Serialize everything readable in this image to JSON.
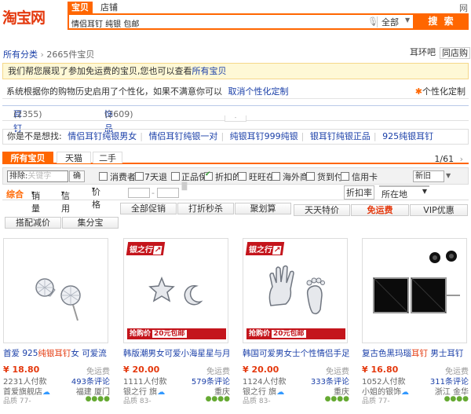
{
  "header": {
    "logo": "淘宝网",
    "tabs": [
      "宝贝",
      "店铺"
    ],
    "corner_text": "网",
    "search_value": "情侣耳钉 纯银 包邮",
    "category": "全部",
    "search_button": "搜 索"
  },
  "breadcrumb": {
    "root": "所有分类",
    "separator": "›",
    "count": "2665件宝贝",
    "right_links": [
      "耳环吧",
      "同店购"
    ]
  },
  "tips": {
    "free_ship": "我们帮您展现了参加免运费的宝贝,您也可以查看",
    "all_items_link": "所有宝贝",
    "personal": "系统根据你的购物历史启用了个性化，如果不满意你可以",
    "cancel_link": "取消个性化定制",
    "personal_right": "个性化定制"
  },
  "categories": [
    {
      "name": "耳钉",
      "count": "(2355)"
    },
    {
      "name": "饰品",
      "count": "(2609)"
    }
  ],
  "suggest": {
    "label": "你是不是想找:",
    "items": [
      "情侣耳钉纯银男女",
      "情侣耳钉纯银一对",
      "纯银耳钉999纯银",
      "银耳钉纯银正品",
      "925纯银耳钉"
    ]
  },
  "tabs": [
    "所有宝贝",
    "天猫",
    "二手"
  ],
  "pager": {
    "current": "1",
    "total": "/61"
  },
  "filter": {
    "sort_label": "排除:",
    "sort_placeholder": "关键字",
    "confirm": "确",
    "checks": [
      "消费者",
      "7天退",
      "正品保",
      "折扣的",
      "旺旺在",
      "海外商",
      "货到付",
      "信用卡"
    ],
    "newold": "新旧"
  },
  "sort": {
    "items": [
      "综合",
      "销量",
      "信用",
      "价格"
    ],
    "arrows": [
      "▾",
      "▾",
      "▾"
    ],
    "discount": "折扣率",
    "location": "所在地"
  },
  "promo_row1": [
    "全部促销",
    "打折秒杀",
    "聚划算",
    "天天特价",
    "免运费",
    "VIP优惠"
  ],
  "promo_row2": [
    "搭配减价",
    "集分宝"
  ],
  "banner": {
    "brand": "银之行",
    "text": "抢购价",
    "price": "20元包邮"
  },
  "products": [
    {
      "title_a": "首爱 925",
      "title_b": "纯银耳钉",
      "title_c": "女 可爱流",
      "price": "¥ 18.80",
      "free": "免运费",
      "sold": "2231人付款",
      "comments": "493条评论",
      "shop": "首爱旗舰店",
      "loc": "福建 厦门",
      "credit": "品质 77-"
    },
    {
      "title_a": "韩版潮男女可爱小海星星与月",
      "title_b": "",
      "title_c": "",
      "price": "¥ 20.00",
      "free": "免运费",
      "sold": "1111人付款",
      "comments": "579条评论",
      "shop": "银之行 旗",
      "loc": "重庆",
      "credit": "品质 83-"
    },
    {
      "title_a": "韩国可爱男女士个性情侣手足",
      "title_b": "",
      "title_c": "",
      "price": "¥ 20.00",
      "free": "免运费",
      "sold": "1124人付款",
      "comments": "333条评论",
      "shop": "银之行 旗",
      "loc": "重庆",
      "credit": "品质 83-"
    },
    {
      "title_a": "复古色黑玛瑙",
      "title_b": "耳钉",
      "title_c": " 男士耳钉",
      "price": "¥ 16.80",
      "free": "免运费",
      "sold": "1052人付款",
      "comments": "311条评论",
      "shop": "小姐的银饰",
      "loc": "浙江 金华",
      "credit": "品质 77-"
    }
  ],
  "colors": {
    "accent": "#ff6600",
    "link": "#1a3fa8",
    "price": "#e4390e",
    "band": "#c4151c"
  }
}
